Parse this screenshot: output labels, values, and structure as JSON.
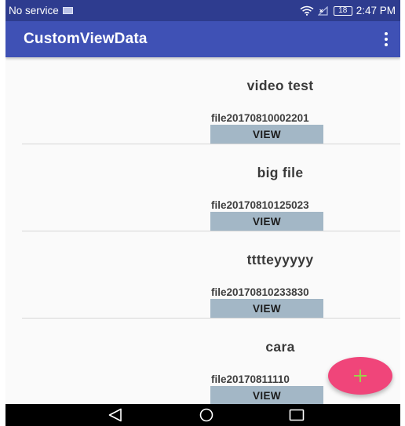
{
  "status_bar": {
    "carrier": "No service",
    "battery": "18",
    "time": "2:47 PM",
    "icons": [
      "sim-icon",
      "wifi-icon",
      "signal-icon",
      "battery-icon"
    ]
  },
  "app_bar": {
    "title": "CustomViewData",
    "menu_icon": "overflow-menu-icon"
  },
  "items": [
    {
      "title": "video test",
      "file": "file20170810002201",
      "button": "VIEW"
    },
    {
      "title": "big file",
      "file": "file20170810125023",
      "button": "VIEW"
    },
    {
      "title": "tttteyyyyy",
      "file": "file20170810233830",
      "button": "VIEW"
    },
    {
      "title": "cara",
      "file": "file20170811110",
      "button": "VIEW"
    }
  ],
  "fab": {
    "icon": "plus-icon"
  },
  "nav_bar": {
    "icons": [
      "back-icon",
      "home-icon",
      "recents-icon"
    ]
  },
  "colors": {
    "status_bar": "#2e3c8f",
    "app_bar": "#3f51b5",
    "background": "#fafafa",
    "button": "#a3b7c6",
    "fab": "#f0457a",
    "fab_icon": "#9ad34a"
  }
}
